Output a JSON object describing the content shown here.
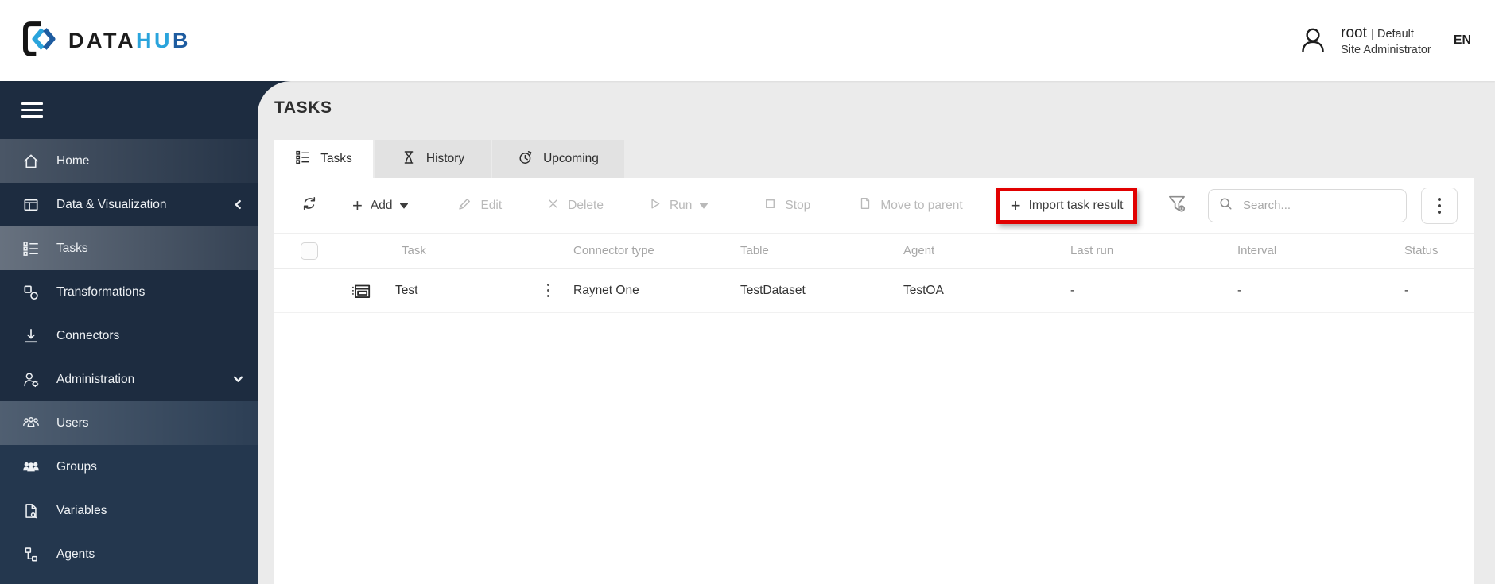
{
  "header": {
    "logo": {
      "text_dark": "DATA",
      "text_light": "HU",
      "text_blue": "B"
    },
    "user": {
      "name": "root",
      "divider": "|",
      "account": "Default",
      "role": "Site Administrator"
    },
    "language": "EN"
  },
  "sidebar": {
    "items": [
      {
        "label": "Home",
        "icon": "home-icon"
      },
      {
        "label": "Data & Visualization",
        "icon": "data-visualization-icon",
        "chevron": "left"
      },
      {
        "label": "Tasks",
        "icon": "tasks-icon",
        "selected": true
      },
      {
        "label": "Transformations",
        "icon": "transformations-icon"
      },
      {
        "label": "Connectors",
        "icon": "connectors-icon"
      },
      {
        "label": "Administration",
        "icon": "administration-icon",
        "chevron": "down",
        "expanded": true
      },
      {
        "label": "Users",
        "icon": "users-icon",
        "submenu": true
      },
      {
        "label": "Groups",
        "icon": "groups-icon",
        "submenu": true
      },
      {
        "label": "Variables",
        "icon": "variables-icon",
        "submenu": true
      },
      {
        "label": "Agents",
        "icon": "agents-icon",
        "submenu": true
      }
    ]
  },
  "main": {
    "title": "TASKS",
    "tabs": [
      {
        "label": "Tasks",
        "icon": "tasks-icon",
        "active": true
      },
      {
        "label": "History",
        "icon": "hourglass-icon",
        "active": false
      },
      {
        "label": "Upcoming",
        "icon": "upcoming-clock-icon",
        "active": false
      }
    ],
    "toolbar": {
      "buttons": [
        {
          "id": "refresh",
          "label": "",
          "icon": "refresh-icon",
          "enabled": true
        },
        {
          "id": "add",
          "label": "Add",
          "icon": "plus-icon",
          "has_caret": true,
          "enabled": true
        },
        {
          "id": "edit",
          "label": "Edit",
          "icon": "pen-icon",
          "enabled": false
        },
        {
          "id": "delete",
          "label": "Delete",
          "icon": "x-icon",
          "enabled": false
        },
        {
          "id": "run",
          "label": "Run",
          "icon": "play-icon",
          "has_caret": true,
          "enabled": false
        },
        {
          "id": "stop",
          "label": "Stop",
          "icon": "stop-icon",
          "enabled": false
        },
        {
          "id": "move-to-parent",
          "label": "Move to parent",
          "icon": "document-icon",
          "enabled": false
        },
        {
          "id": "import-task-result",
          "label": "Import task result",
          "icon": "plus-icon",
          "enabled": true,
          "highlighted": true
        }
      ],
      "filter_icon": "filter-clear-icon",
      "search_placeholder": "Search...",
      "more_icon": "kebab-icon"
    },
    "table": {
      "columns": [
        "Task",
        "Connector type",
        "Table",
        "Agent",
        "Last run",
        "Interval",
        "Status"
      ],
      "rows": [
        {
          "task": "Test",
          "connector_type": "Raynet One",
          "table": "TestDataset",
          "agent": "TestOA",
          "last_run": "-",
          "interval": "-",
          "status": "-"
        }
      ]
    }
  },
  "colors": {
    "accent_red": "#e10000",
    "brand_cyan": "#2aa4dc",
    "brand_blue": "#1e5ca0",
    "sidebar_bg": "#1d2c40",
    "sidebar_submenu_bg": "#24374e"
  }
}
